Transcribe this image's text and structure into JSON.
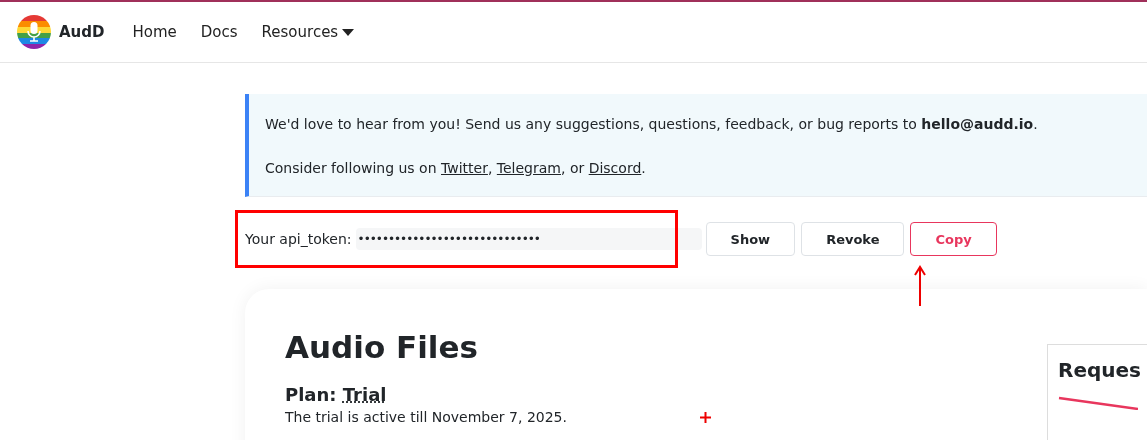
{
  "navbar": {
    "brand": "AudD",
    "links": [
      {
        "label": "Home",
        "kind": "link"
      },
      {
        "label": "Docs",
        "kind": "link"
      },
      {
        "label": "Resources",
        "kind": "dropdown"
      }
    ]
  },
  "notice": {
    "line1": "We'd love to hear from you! Send us any suggestions, questions, feedback, or bug reports to **hello@audd.io**.",
    "line2_prefix": "Consider following us on",
    "links": [
      "Twitter",
      "Telegram",
      "Discord"
    ],
    "sep1": ",",
    "sep2": ", or",
    "end": "."
  },
  "token": {
    "label": "Your api_token:",
    "value": "••••••••••••••••••••••••••••••",
    "buttons": [
      {
        "label": "Show",
        "kind": "plain"
      },
      {
        "label": "Revoke",
        "kind": "plain"
      },
      {
        "label": "Copy",
        "kind": "accent"
      }
    ]
  },
  "card": {
    "title": "Audio Files",
    "plan_label": "Plan:",
    "plan": "Trial",
    "status": "The trial is active till November 7, 2025.",
    "side_title": "Reques"
  }
}
